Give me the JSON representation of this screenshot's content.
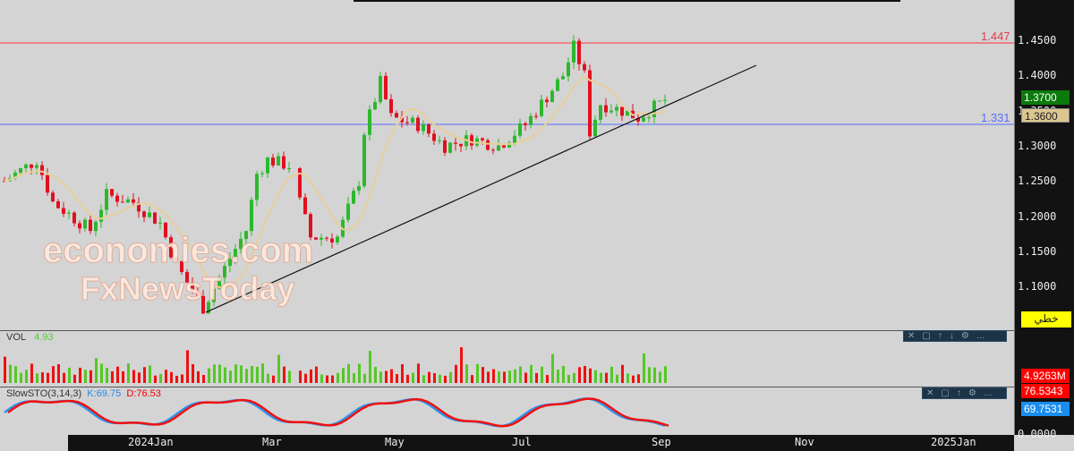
{
  "price_axis": {
    "ticks": [
      "1.4500",
      "1.4000",
      "1.3500",
      "1.3000",
      "1.2500",
      "1.2000",
      "1.1500",
      "1.1000"
    ],
    "current_tag": "1.3700",
    "cursor_tag": "1.3600",
    "mode_button": "خطي"
  },
  "levels": {
    "resistance": "1.447",
    "support": "1.331",
    "resistance_color": "#ff3040",
    "support_color": "#5a6cff"
  },
  "volume": {
    "label": "VOL",
    "value": "4.93",
    "axis_tag": "4.9263M"
  },
  "stoch": {
    "label": "SlowSTO(3,14,3)",
    "k": "K:69.75",
    "d": "D:76.53",
    "d_tag": "76.5343",
    "k_tag": "69.7531",
    "zero": "0.0000"
  },
  "x_axis": [
    "2024Jan",
    "Mar",
    "May",
    "Jul",
    "Sep",
    "Nov",
    "2025Jan"
  ],
  "watermark": {
    "line1": "economies.com",
    "line2": "FxNewsToday"
  },
  "chart_data": {
    "type": "candlestick",
    "ylim": [
      1.06,
      1.48
    ],
    "path": [
      [
        0,
        1.25
      ],
      [
        6,
        1.28
      ],
      [
        9,
        1.22
      ],
      [
        16,
        1.18
      ],
      [
        19,
        1.23
      ],
      [
        24,
        1.22
      ],
      [
        29,
        1.19
      ],
      [
        32,
        1.13
      ],
      [
        37,
        1.07
      ],
      [
        42,
        1.14
      ],
      [
        45,
        1.18
      ],
      [
        47,
        1.26
      ],
      [
        49,
        1.28
      ],
      [
        54,
        1.27
      ],
      [
        55,
        1.22
      ],
      [
        57,
        1.17
      ],
      [
        62,
        1.17
      ],
      [
        66,
        1.25
      ],
      [
        67,
        1.32
      ],
      [
        70,
        1.39
      ],
      [
        72,
        1.34
      ],
      [
        77,
        1.33
      ],
      [
        82,
        1.3
      ],
      [
        87,
        1.31
      ],
      [
        92,
        1.3
      ],
      [
        97,
        1.33
      ],
      [
        100,
        1.36
      ],
      [
        104,
        1.4
      ],
      [
        106,
        1.44
      ],
      [
        108,
        1.4
      ],
      [
        109,
        1.32
      ],
      [
        111,
        1.36
      ],
      [
        115,
        1.35
      ],
      [
        118,
        1.34
      ],
      [
        123,
        1.365
      ]
    ]
  }
}
